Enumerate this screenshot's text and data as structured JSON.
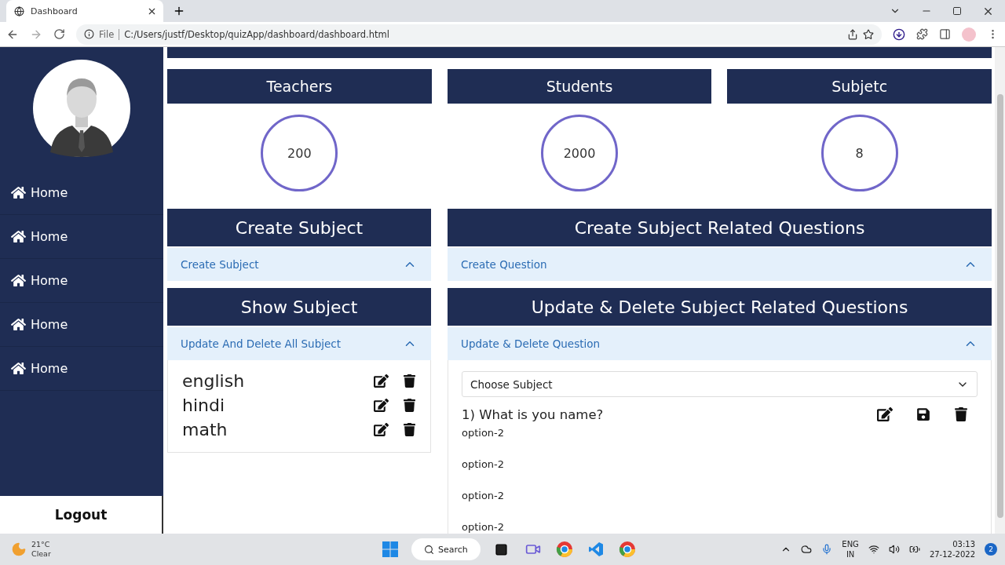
{
  "browser": {
    "tab_title": "Dashboard",
    "url_scheme": "File",
    "url": "C:/Users/justf/Desktop/quizApp/dashboard/dashboard.html"
  },
  "sidebar": {
    "nav": [
      {
        "label": "Home"
      },
      {
        "label": "Home"
      },
      {
        "label": "Home"
      },
      {
        "label": "Home"
      },
      {
        "label": "Home"
      }
    ],
    "logout": "Logout"
  },
  "stats": [
    {
      "label": "Teachers",
      "value": "200"
    },
    {
      "label": "Students",
      "value": "2000"
    },
    {
      "label": "Subjetc",
      "value": "8"
    }
  ],
  "create_subject": {
    "title": "Create Subject",
    "accordion": {
      "label": "Create Subject",
      "expanded": true
    }
  },
  "create_question": {
    "title": "Create Subject Related Questions",
    "accordion": {
      "label": "Create Question",
      "expanded": true
    }
  },
  "show_subject": {
    "title": "Show Subject",
    "accordion": {
      "label": "Update And Delete All Subject",
      "expanded": true
    },
    "subjects": [
      "english",
      "hindi",
      "math"
    ]
  },
  "update_questions": {
    "title": "Update & Delete Subject Related Questions",
    "accordion": {
      "label": "Update & Delete Question",
      "expanded": true
    },
    "select": {
      "value": "Choose Subject"
    },
    "question": "1) What is you name?",
    "options": [
      "option-2",
      "option-2",
      "option-2",
      "option-2"
    ]
  },
  "taskbar": {
    "temperature": "21°C",
    "weather": "Clear",
    "search": "Search",
    "lang": "ENG",
    "region": "IN",
    "time": "03:13",
    "date": "27-12-2022",
    "notifications": "2"
  }
}
